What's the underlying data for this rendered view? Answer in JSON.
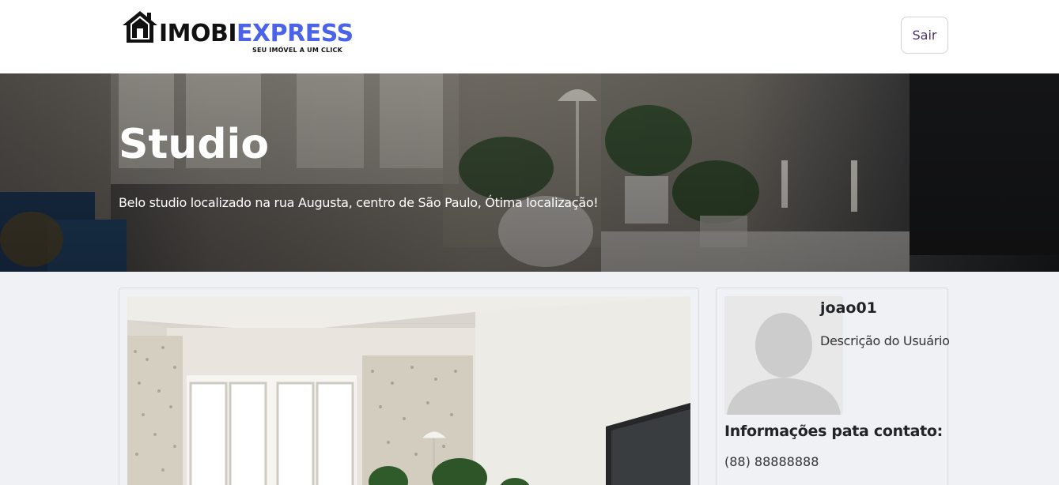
{
  "header": {
    "logo_part1": "IMOBI",
    "logo_part2": "EXPRESS",
    "logo_tagline": "SEU IMÓVEL A UM  CLICK",
    "logout_label": "Sair"
  },
  "listing": {
    "title": "Studio",
    "description": "Belo studio localizado na rua Augusta, centro de São Paulo, Ótima localização!"
  },
  "owner": {
    "username": "joao01",
    "description": "Descrição do Usuário",
    "contact_title": "Informações pata contato:",
    "phone": "(88) 88888888"
  },
  "colors": {
    "brand_blue": "#4a63e8",
    "logout_text": "#4b2f6b",
    "page_background": "#eff1f4"
  },
  "icons": {
    "logo": "house-icon",
    "avatar": "user-silhouette-icon"
  }
}
